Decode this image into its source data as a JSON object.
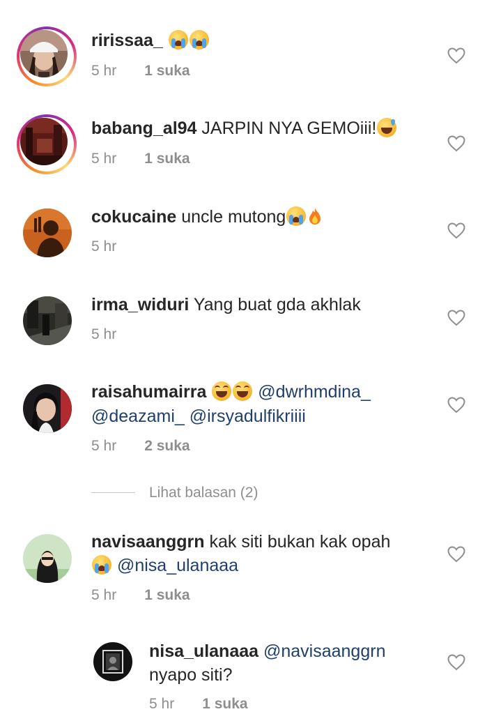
{
  "comments": [
    {
      "username": "ririssaa_",
      "text": "",
      "time": "5 hr",
      "likes": "1 suka",
      "avatar": "woman-white-cap-photo"
    },
    {
      "username": "babang_al94",
      "text": "JARPIN NYA GEMOiii!",
      "time": "5 hr",
      "likes": "1 suka",
      "avatar": "dark-red-room-photo"
    },
    {
      "username": "cokucaine",
      "text": "uncle mutong",
      "time": "5 hr",
      "likes": "",
      "avatar": "orange-silhouette-photo"
    },
    {
      "username": "irma_widuri",
      "text": "Yang buat gda akhlak",
      "time": "5 hr",
      "likes": "",
      "avatar": "night-street-photo"
    },
    {
      "username": "raisahumairra",
      "mention1": "@dwrhmdina_",
      "mention2": "@deazami_",
      "mention3": "@irsyadulfikriiii",
      "time": "5 hr",
      "likes": "2 suka",
      "avatar": "girl-portrait-photo"
    },
    {
      "username": "navisaanggrn",
      "text": "kak siti bukan kak opah",
      "mention": "@nisa_ulanaaa",
      "time": "5 hr",
      "likes": "1 suka",
      "avatar": "hijab-cartoon-avatar"
    }
  ],
  "view_replies": "Lihat balasan (2)",
  "reply": {
    "username": "nisa_ulanaaa",
    "mention": "@navisaanggrn",
    "text": "nyapo siti?",
    "time": "5 hr",
    "likes": "1 suka",
    "avatar": "framed-dark-photo"
  },
  "icons": {
    "like": "heart-outline-icon",
    "emoji_crying": "loudly-crying-face-emoji",
    "emoji_laughing": "face-with-tears-of-joy-emoji",
    "emoji_sweat": "grinning-face-with-sweat-emoji",
    "emoji_fire": "fire-emoji"
  },
  "colors": {
    "mention": "#1f3f6e",
    "meta": "#8e8e8e",
    "text": "#262626",
    "story_ring": "#dd2a7b"
  }
}
